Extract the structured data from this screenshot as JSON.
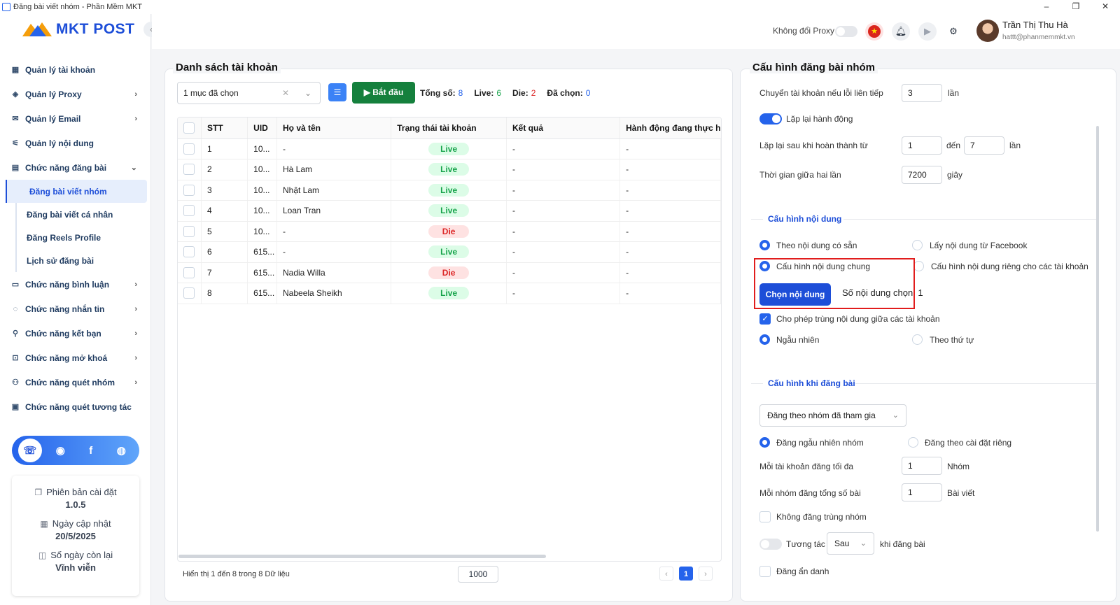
{
  "window": {
    "title": "Đăng bài viết nhóm - Phần Mềm MKT"
  },
  "brand": {
    "logo_text": "MKT POST"
  },
  "sidebar": {
    "items": [
      {
        "label": "Quản lý tài khoản"
      },
      {
        "label": "Quản lý Proxy"
      },
      {
        "label": "Quản lý Email"
      },
      {
        "label": "Quản lý nội dung"
      },
      {
        "label": "Chức năng đăng bài"
      },
      {
        "label": "Chức năng bình luận"
      },
      {
        "label": "Chức năng nhắn tin"
      },
      {
        "label": "Chức năng kết bạn"
      },
      {
        "label": "Chức năng mở khoá"
      },
      {
        "label": "Chức năng quét nhóm"
      },
      {
        "label": "Chức năng quét tương tác"
      }
    ],
    "sub_items": [
      {
        "label": "Đăng bài viết nhóm"
      },
      {
        "label": "Đăng bài viết cá nhân"
      },
      {
        "label": "Đăng Reels Profile"
      },
      {
        "label": "Lịch sử đăng bài"
      }
    ]
  },
  "info": {
    "version_label": "Phiên bản cài đặt",
    "version_value": "1.0.5",
    "update_label": "Ngày cập nhật",
    "update_value": "20/5/2025",
    "remaining_label": "Số ngày còn lại",
    "remaining_value": "Vĩnh viễn"
  },
  "header": {
    "proxy_label": "Không đổi Proxy",
    "user_name": "Trần Thị Thu Hà",
    "user_email": "hattt@phanmemmkt.vn"
  },
  "accounts": {
    "title": "Danh sách tài khoản",
    "select_value": "1 mục đã chọn",
    "start_label": "Bắt đầu",
    "total_label": "Tổng số:",
    "total_value": "8",
    "live_label": "Live:",
    "live_value": "6",
    "die_label": "Die:",
    "die_value": "2",
    "selected_label": "Đã chọn:",
    "selected_value": "0",
    "columns": [
      "STT",
      "UID",
      "Họ và tên",
      "Trạng thái tài khoản",
      "Kết quả",
      "Hành động đang thực h"
    ],
    "rows": [
      {
        "stt": "1",
        "uid": "10...",
        "name": "-",
        "status": "Live",
        "result": "-",
        "action": "-"
      },
      {
        "stt": "2",
        "uid": "10...",
        "name": "Hà Lam",
        "status": "Live",
        "result": "-",
        "action": "-"
      },
      {
        "stt": "3",
        "uid": "10...",
        "name": "Nhật Lam",
        "status": "Live",
        "result": "-",
        "action": "-"
      },
      {
        "stt": "4",
        "uid": "10...",
        "name": "Loan Tran",
        "status": "Live",
        "result": "-",
        "action": "-"
      },
      {
        "stt": "5",
        "uid": "10...",
        "name": "-",
        "status": "Die",
        "result": "-",
        "action": "-"
      },
      {
        "stt": "6",
        "uid": "615...",
        "name": "-",
        "status": "Live",
        "result": "-",
        "action": "-"
      },
      {
        "stt": "7",
        "uid": "615...",
        "name": "Nadia Willa",
        "status": "Die",
        "result": "-",
        "action": "-"
      },
      {
        "stt": "8",
        "uid": "615...",
        "name": "Nabeela Sheikh",
        "status": "Live",
        "result": "-",
        "action": "-"
      }
    ],
    "footer_text": "Hiển thị 1 đến 8 trong 8 Dữ liệu",
    "page_size": "1000",
    "current_page": "1"
  },
  "config": {
    "title": "Cấu hình đăng bài nhóm",
    "switch_label": "Chuyển tài khoản nếu lỗi liên tiếp",
    "switch_value": "3",
    "switch_unit": "lần",
    "repeat_label": "Lặp lại hành động",
    "repeat_after_label": "Lặp lại sau khi hoàn thành từ",
    "repeat_from": "1",
    "repeat_to_label": "đến",
    "repeat_to": "7",
    "repeat_unit": "lần",
    "interval_label": "Thời gian giữa hai lần",
    "interval_value": "7200",
    "interval_unit": "giây",
    "content_section": "Cấu hình nội dung",
    "opt_available": "Theo nội dung có sẵn",
    "opt_facebook": "Lấy nội dung từ Facebook",
    "opt_common": "Cấu hình nội dung chung",
    "opt_separate": "Cấu hình nội dung riêng cho các tài khoản",
    "choose_button": "Chọn nội dung",
    "count_label": "Số nội dung chọn: 1",
    "allow_duplicate": "Cho phép trùng nội dung giữa các tài khoản",
    "random_label": "Ngẫu nhiên",
    "order_label": "Theo thứ tự",
    "posting_section": "Cấu hình khi đăng bài",
    "group_select": "Đăng theo nhóm đã tham gia",
    "random_group": "Đăng ngẫu nhiên nhóm",
    "custom_group": "Đăng theo cài đặt riêng",
    "max_per_account_label": "Mỗi tài khoản đăng tối đa",
    "max_per_account_value": "1",
    "max_per_account_unit": "Nhóm",
    "max_per_group_label": "Mỗi nhóm đăng tổng số bài",
    "max_per_group_value": "1",
    "max_per_group_unit": "Bài viết",
    "no_duplicate_group": "Không đăng trùng nhóm",
    "interact_label": "Tương tác",
    "interact_select": "Sau",
    "interact_suffix": "khi đăng bài",
    "anonymous_label": "Đăng ẩn danh"
  }
}
